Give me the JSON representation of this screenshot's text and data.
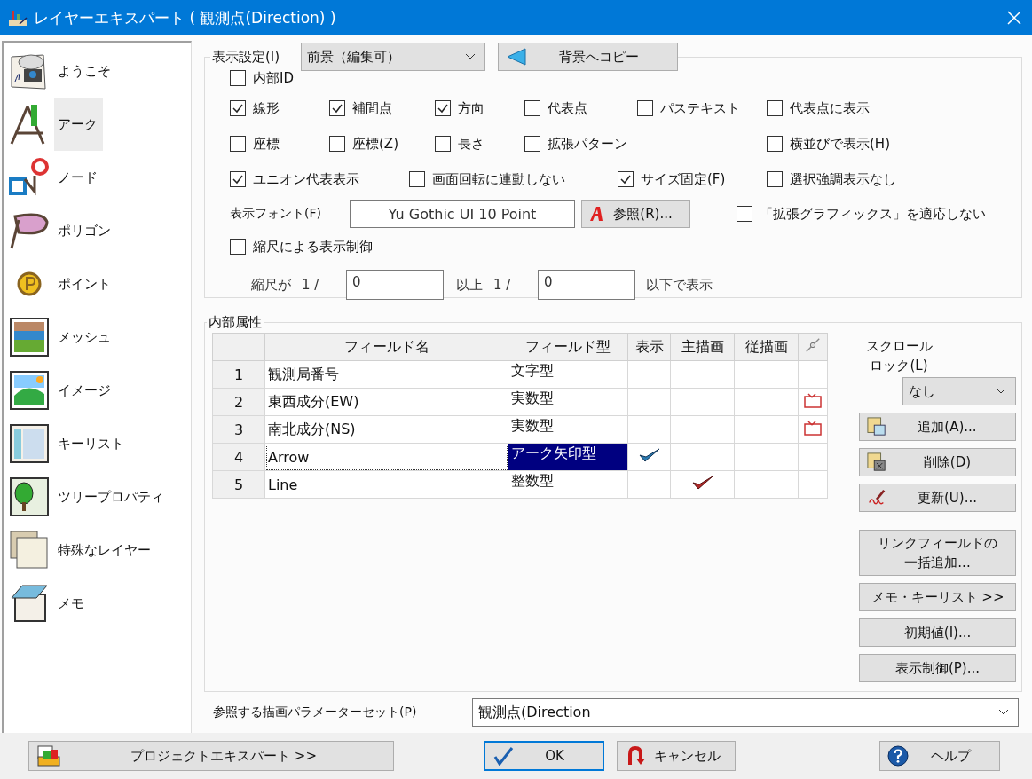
{
  "window": {
    "title": "レイヤーエキスパート ( 観測点(Direction) )"
  },
  "sidebar": {
    "items": [
      {
        "label": "ようこそ",
        "selected": false
      },
      {
        "label": "アーク",
        "selected": true
      },
      {
        "label": "ノード",
        "selected": false
      },
      {
        "label": "ポリゴン",
        "selected": false
      },
      {
        "label": "ポイント",
        "selected": false
      },
      {
        "label": "メッシュ",
        "selected": false
      },
      {
        "label": "イメージ",
        "selected": false
      },
      {
        "label": "キーリスト",
        "selected": false
      },
      {
        "label": "ツリープロパティ",
        "selected": false
      },
      {
        "label": "特殊なレイヤー",
        "selected": false
      },
      {
        "label": "メモ",
        "selected": false
      }
    ]
  },
  "display_settings": {
    "title": "表示設定(I)",
    "mode_dropdown": "前景（編集可）",
    "copy_button": "背景へコピー",
    "checkbox_rows": [
      [
        {
          "label": "内部ID",
          "checked": false
        }
      ],
      [
        {
          "label": "線形",
          "checked": true
        },
        {
          "label": "補間点",
          "checked": true
        },
        {
          "label": "方向",
          "checked": true
        },
        {
          "label": "代表点",
          "checked": false
        },
        {
          "label": "パステキスト",
          "checked": false
        },
        {
          "label": "代表点に表示",
          "checked": false
        }
      ],
      [
        {
          "label": "座標",
          "checked": false
        },
        {
          "label": "座標(Z)",
          "checked": false
        },
        {
          "label": "長さ",
          "checked": false
        },
        {
          "label": "拡張パターン",
          "checked": false
        },
        {
          "label": "横並びで表示(H)",
          "checked": false
        }
      ],
      [
        {
          "label": "ユニオン代表表示",
          "checked": true
        },
        {
          "label": "画面回転に連動しない",
          "checked": false
        },
        {
          "label": "サイズ固定(F)",
          "checked": true
        },
        {
          "label": "選択強調表示なし",
          "checked": false
        }
      ]
    ],
    "font_label": "表示フォント(F)",
    "font_value": "Yu Gothic UI 10 Point",
    "browse_button": "参照(R)...",
    "graphics_checkbox": {
      "label": "「拡張グラフィックス」を適応しない",
      "checked": false
    },
    "scale_checkbox": {
      "label": "縮尺による表示制御",
      "checked": false
    },
    "scale_prefix": "縮尺が",
    "scale_ratio_1": "1 /",
    "scale_min": "0",
    "scale_mid": "以上",
    "scale_ratio_2": "1 /",
    "scale_max": "0",
    "scale_suffix": "以下で表示"
  },
  "internal_attributes": {
    "title": "内部属性",
    "table": {
      "columns": [
        "フィールド名",
        "フィールド型",
        "表示",
        "主描画",
        "従描画"
      ],
      "rows": [
        {
          "number": "1",
          "name": "観測局番号",
          "type": "文字型",
          "display_check": false,
          "main_check": false,
          "link_icon": false,
          "selected": false
        },
        {
          "number": "2",
          "name": "東西成分(EW)",
          "type": "実数型",
          "display_check": false,
          "main_check": false,
          "link_icon": true,
          "selected": false
        },
        {
          "number": "3",
          "name": "南北成分(NS)",
          "type": "実数型",
          "display_check": false,
          "main_check": false,
          "link_icon": true,
          "selected": false
        },
        {
          "number": "4",
          "name": "Arrow",
          "type": "アーク矢印型",
          "display_check": true,
          "main_check": false,
          "link_icon": false,
          "selected": true
        },
        {
          "number": "5",
          "name": "Line",
          "type": "整数型",
          "display_check": false,
          "main_check": true,
          "link_icon": false,
          "selected": false
        }
      ]
    },
    "scroll_lock_label": "スクロールロック(L)",
    "scroll_lock_value": "なし",
    "buttons": [
      {
        "label": "追加(A)...",
        "kind": "add"
      },
      {
        "label": "削除(D)",
        "kind": "delete"
      },
      {
        "label": "更新(U)...",
        "kind": "update"
      },
      {
        "label": "リンクフィールドの一括追加...",
        "kind": "plain"
      },
      {
        "label": "メモ・キーリスト >>",
        "kind": "plain"
      },
      {
        "label": "初期値(I)...",
        "kind": "plain"
      },
      {
        "label": "表示制御(P)...",
        "kind": "plain"
      }
    ]
  },
  "parameter_set": {
    "label": "参照する描画パラメーターセット(P)",
    "value": "観測点(Direction"
  },
  "footer": {
    "project_button": "プロジェクトエキスパート >>",
    "ok_button": "OK",
    "cancel_button": "キャンセル",
    "help_button": "ヘルプ"
  }
}
